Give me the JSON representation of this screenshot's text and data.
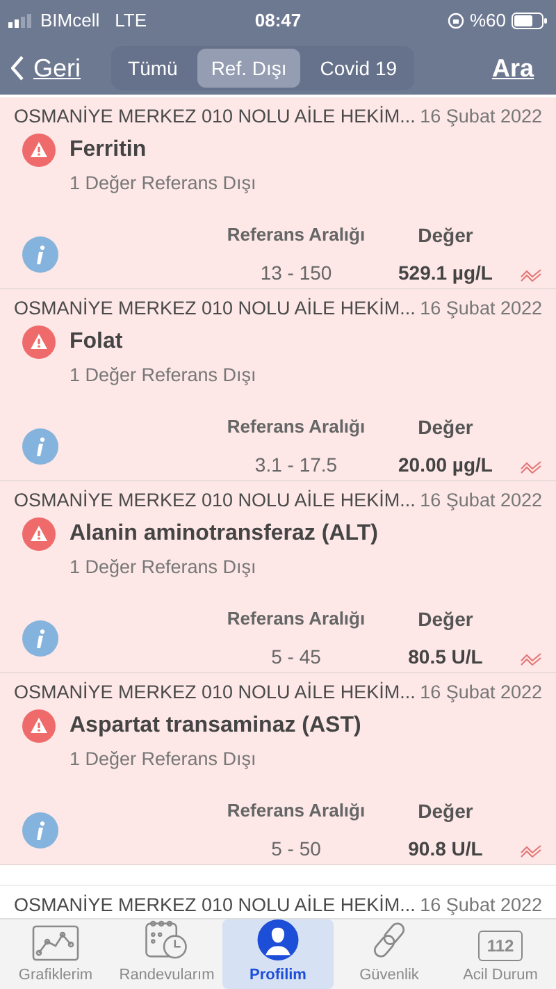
{
  "status_bar": {
    "carrier": "BIMcell",
    "network": "LTE",
    "time": "08:47",
    "battery": "%60"
  },
  "nav": {
    "back": "Geri",
    "tabs": [
      {
        "label": "Tümü",
        "selected": false
      },
      {
        "label": "Ref. Dışı",
        "selected": true
      },
      {
        "label": "Covid 19",
        "selected": false
      }
    ],
    "action": "Ara"
  },
  "results": [
    {
      "clinic": "OSMANİYE MERKEZ 010 NOLU AİLE HEKİM...",
      "date": "16 Şubat 2022",
      "test": "Ferritin",
      "summary": "1 Değer Referans Dışı",
      "range_label": "Referans Aralığı",
      "value_label": "Değer",
      "range": "13 - 150",
      "value": "529.1 µg/L",
      "out_of_range": true
    },
    {
      "clinic": "OSMANİYE MERKEZ 010 NOLU AİLE HEKİM...",
      "date": "16 Şubat 2022",
      "test": "Folat",
      "summary": "1 Değer Referans Dışı",
      "range_label": "Referans Aralığı",
      "value_label": "Değer",
      "range": "3.1 - 17.5",
      "value": "20.00 µg/L",
      "out_of_range": true
    },
    {
      "clinic": "OSMANİYE MERKEZ 010 NOLU AİLE HEKİM...",
      "date": "16 Şubat 2022",
      "test": "Alanin aminotransferaz (ALT)",
      "summary": "1 Değer Referans Dışı",
      "range_label": "Referans Aralığı",
      "value_label": "Değer",
      "range": "5 - 45",
      "value": "80.5 U/L",
      "out_of_range": true
    },
    {
      "clinic": "OSMANİYE MERKEZ 010 NOLU AİLE HEKİM...",
      "date": "16 Şubat 2022",
      "test": "Aspartat transaminaz (AST)",
      "summary": "1 Değer Referans Dışı",
      "range_label": "Referans Aralığı",
      "value_label": "Değer",
      "range": "5 - 50",
      "value": "90.8 U/L",
      "out_of_range": true
    }
  ],
  "partial_result": {
    "clinic": "OSMANİYE MERKEZ 010 NOLU AİLE HEKİM...",
    "date": "16 Şubat 2022"
  },
  "tab_bar": [
    {
      "kind": "chart",
      "label": "Grafiklerim",
      "selected": false
    },
    {
      "kind": "calendar",
      "label": "Randevularım",
      "selected": false
    },
    {
      "kind": "profile",
      "label": "Profilim",
      "selected": true
    },
    {
      "kind": "link",
      "label": "Güvenlik",
      "selected": false
    },
    {
      "kind": "emergency",
      "label": "Acil Durum",
      "badge": "112",
      "selected": false
    }
  ]
}
